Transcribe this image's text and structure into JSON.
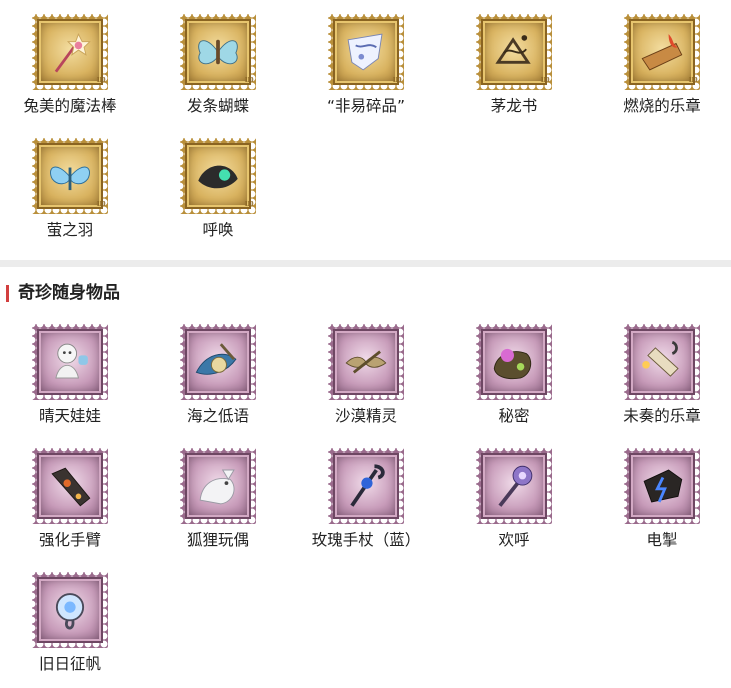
{
  "top_items": [
    {
      "label": "兔美的魔法棒",
      "icon": "magic-wand-icon"
    },
    {
      "label": "发条蝴蝶",
      "icon": "clockwork-butterfly-icon"
    },
    {
      "label": "“非易碎品”",
      "icon": "fragile-item-icon"
    },
    {
      "label": "茅龙书",
      "icon": "dragon-book-icon"
    },
    {
      "label": "燃烧的乐章",
      "icon": "burning-music-icon"
    },
    {
      "label": "萤之羽",
      "icon": "firefly-wing-icon"
    },
    {
      "label": "呼唤",
      "icon": "summon-icon"
    }
  ],
  "stamp_tag": "110",
  "section": {
    "title": "奇珍随身物品"
  },
  "bottom_items": [
    {
      "label": "晴天娃娃",
      "icon": "sunny-doll-icon"
    },
    {
      "label": "海之低语",
      "icon": "sea-whisper-icon"
    },
    {
      "label": "沙漠精灵",
      "icon": "desert-sprite-icon"
    },
    {
      "label": "秘密",
      "icon": "secret-icon"
    },
    {
      "label": "未奏的乐章",
      "icon": "unplayed-music-icon"
    },
    {
      "label": "强化手臂",
      "icon": "enhanced-arm-icon"
    },
    {
      "label": "狐狸玩偶",
      "icon": "fox-doll-icon"
    },
    {
      "label": "玫瑰手杖（蓝）",
      "icon": "rose-cane-blue-icon"
    },
    {
      "label": "欢呼",
      "icon": "cheer-icon"
    },
    {
      "label": "电掣",
      "icon": "lightning-icon"
    },
    {
      "label": "旧日征帆",
      "icon": "old-voyage-icon"
    }
  ]
}
